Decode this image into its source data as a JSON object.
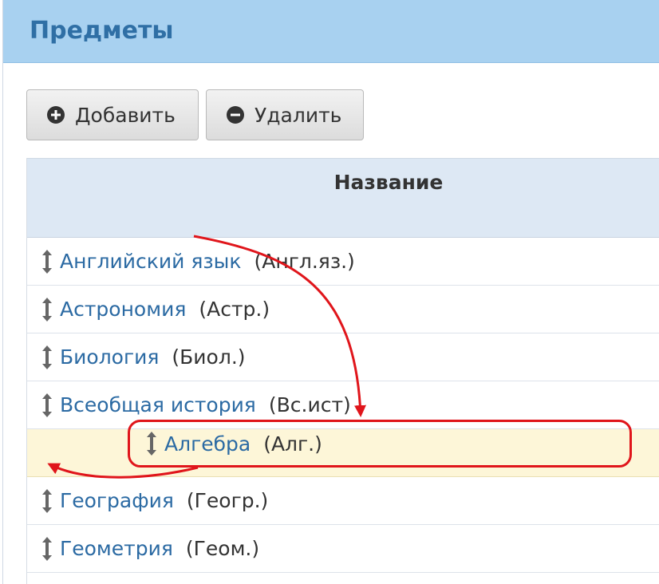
{
  "panel": {
    "title": "Предметы"
  },
  "toolbar": {
    "add_label": "Добавить",
    "delete_label": "Удалить"
  },
  "table": {
    "header": "Название",
    "rows": [
      {
        "name": "Английский язык",
        "abbr": "(Англ.яз.)"
      },
      {
        "name": "Астрономия",
        "abbr": "(Астр.)"
      },
      {
        "name": "Биология",
        "abbr": "(Биол.)"
      },
      {
        "name": "Всеобщая история",
        "abbr": "(Вс.ист)"
      },
      {
        "name": "География",
        "abbr": "(Геогр.)"
      },
      {
        "name": "Геометрия",
        "abbr": "(Геом.)"
      }
    ]
  },
  "dragging": {
    "name": "Алгебра",
    "abbr": "(Алг.)"
  },
  "icons": {
    "add": "plus-circle-icon",
    "delete": "minus-circle-icon",
    "handle": "vertical-resize-arrow-icon"
  },
  "colors": {
    "header_bg": "#a8d1f0",
    "title": "#2f6fa5",
    "link": "#2b6aa3",
    "placeholder": "#fdf6d8",
    "annotation": "#e0151b"
  }
}
